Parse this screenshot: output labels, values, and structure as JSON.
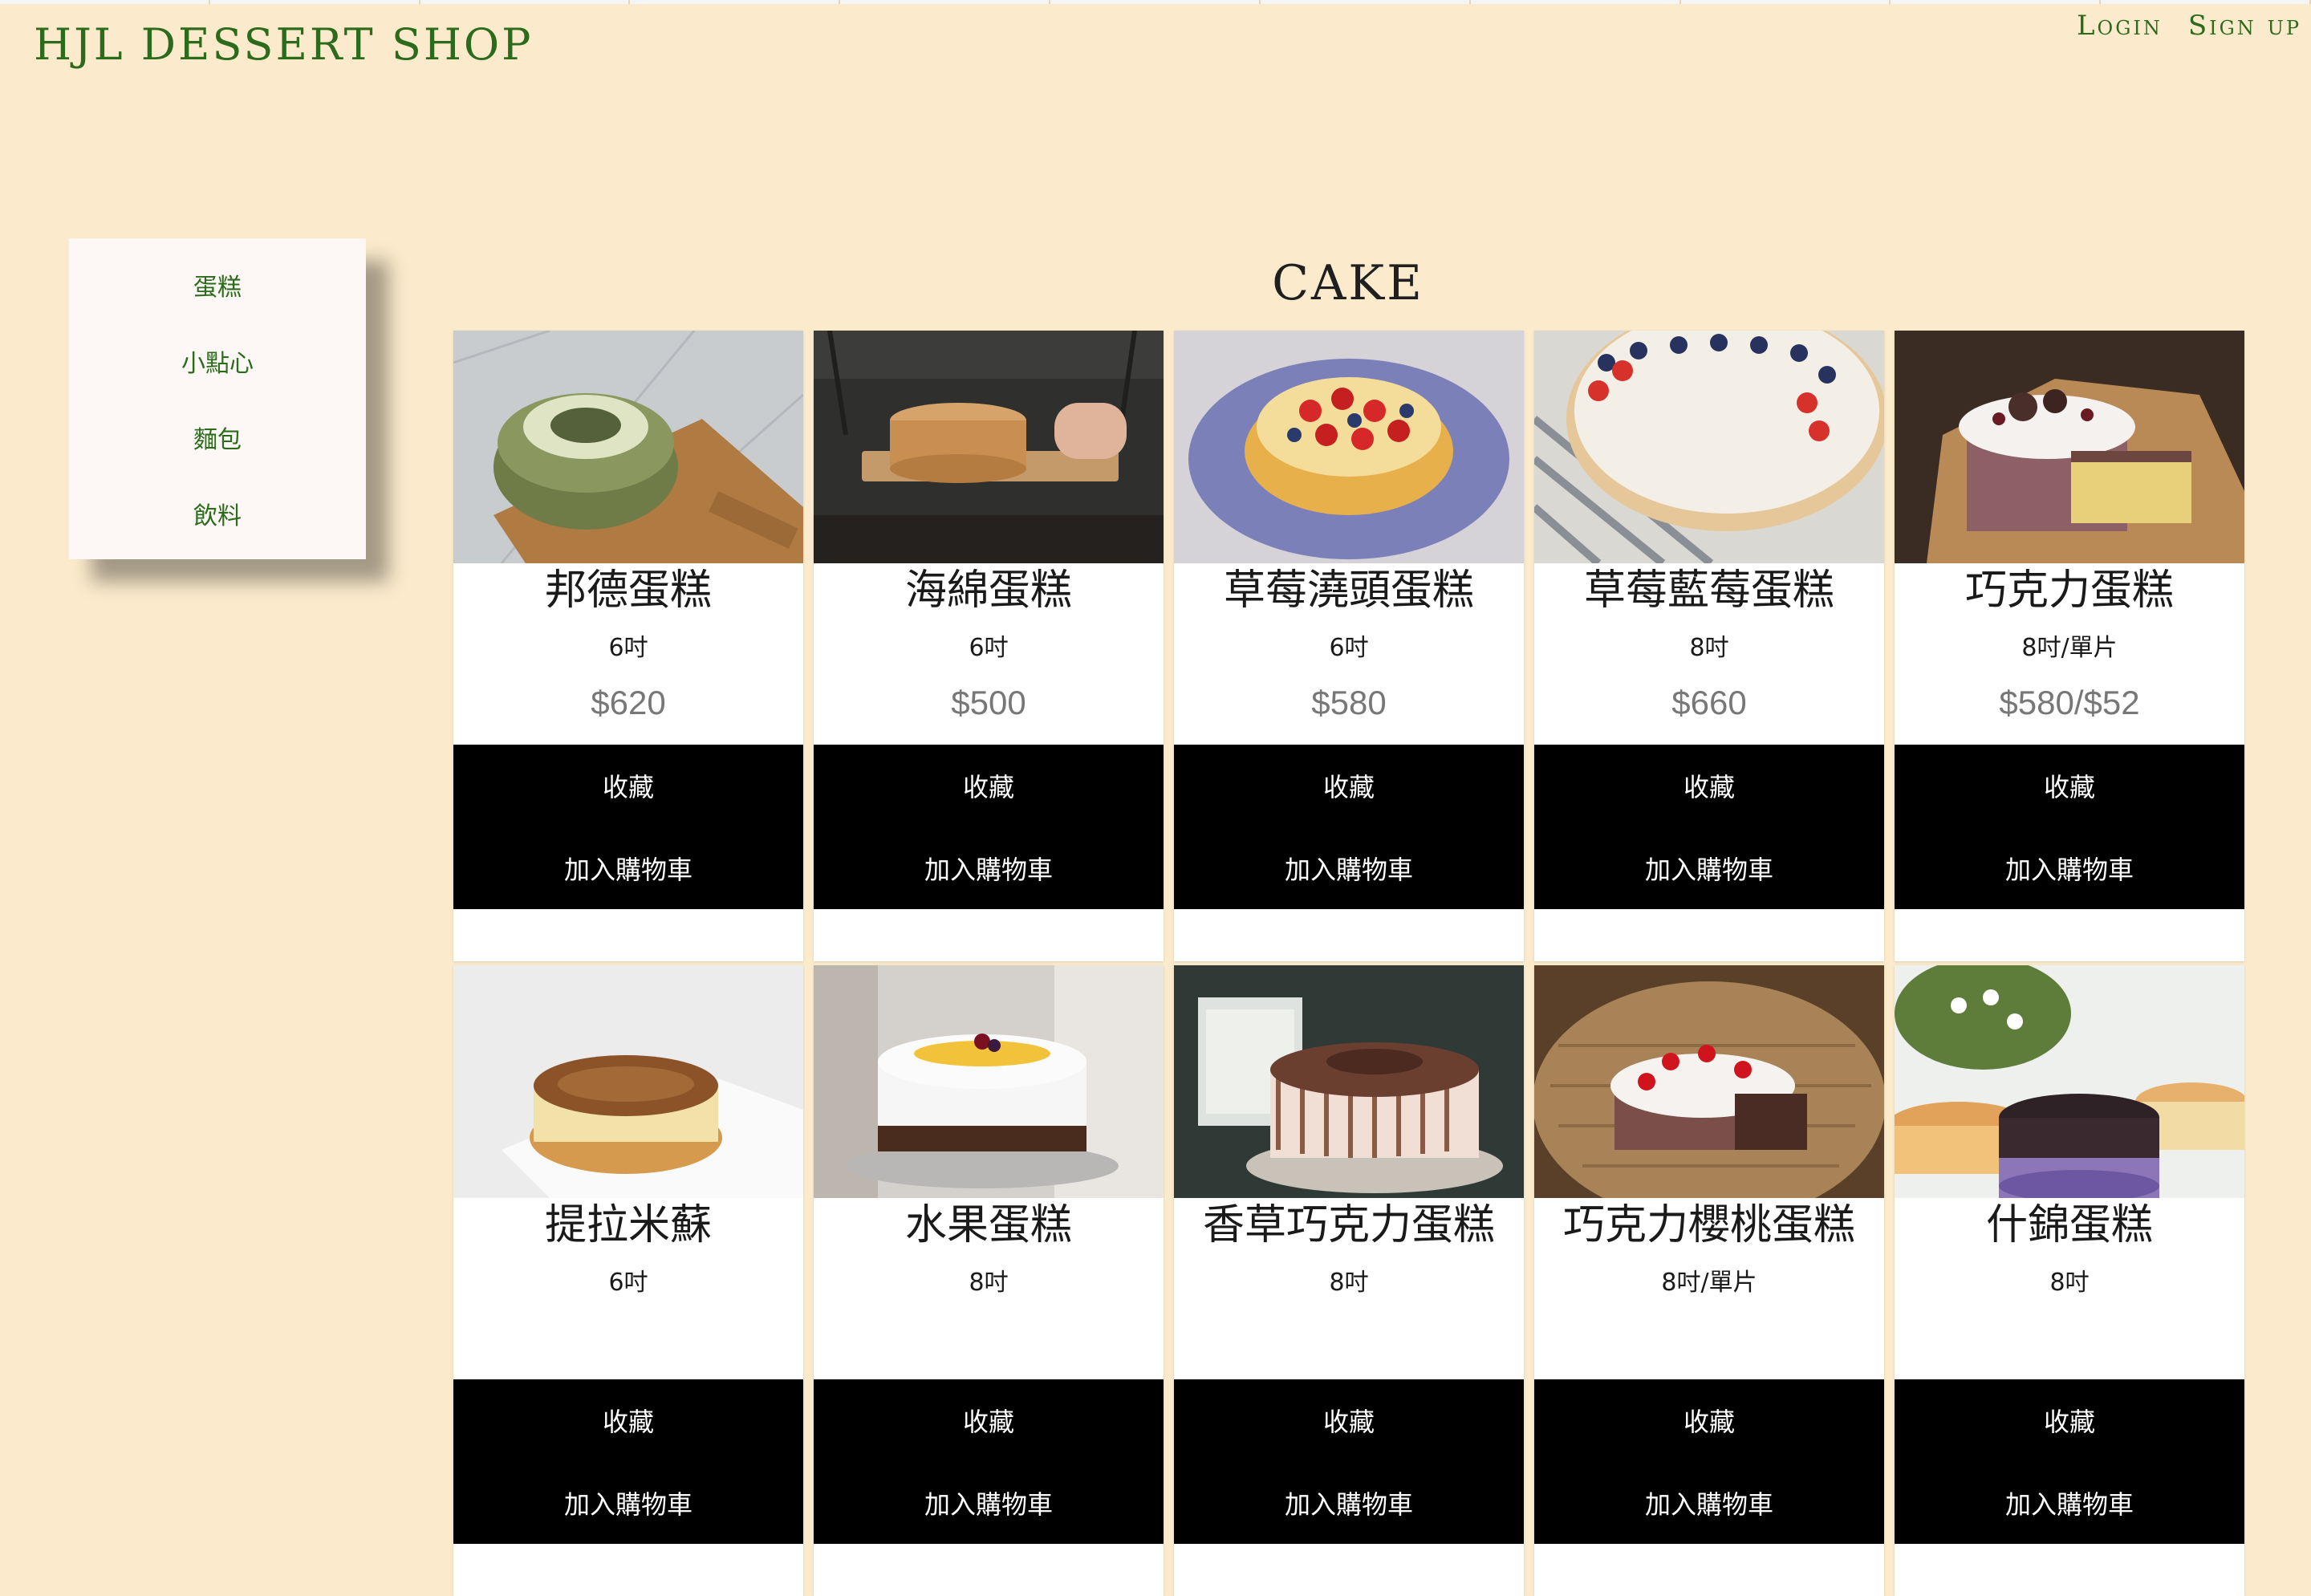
{
  "brand": "HJL DESSERT SHOP",
  "auth": {
    "login": "Login",
    "signup": "Sign up"
  },
  "sidebar": {
    "items": [
      {
        "label": "蛋糕"
      },
      {
        "label": "小點心"
      },
      {
        "label": "麵包"
      },
      {
        "label": "飲料"
      }
    ]
  },
  "section_title": "CAKE",
  "actions": {
    "favorite": "收藏",
    "add_to_cart": "加入購物車"
  },
  "products": [
    {
      "name": "邦德蛋糕",
      "size": "6吋",
      "price": "$620"
    },
    {
      "name": "海綿蛋糕",
      "size": "6吋",
      "price": "$500"
    },
    {
      "name": "草莓澆頭蛋糕",
      "size": "6吋",
      "price": "$580"
    },
    {
      "name": "草莓藍莓蛋糕",
      "size": "8吋",
      "price": "$660"
    },
    {
      "name": "巧克力蛋糕",
      "size": "8吋/單片",
      "price": "$580/$52"
    },
    {
      "name": "提拉米蘇",
      "size": "6吋",
      "price": ""
    },
    {
      "name": "水果蛋糕",
      "size": "8吋",
      "price": ""
    },
    {
      "name": "香草巧克力蛋糕",
      "size": "8吋",
      "price": ""
    },
    {
      "name": "巧克力櫻桃蛋糕",
      "size": "8吋/單片",
      "price": ""
    },
    {
      "name": "什錦蛋糕",
      "size": "8吋",
      "price": ""
    }
  ],
  "colors": {
    "background": "#fbebcc",
    "brand_green": "#2c6b1c",
    "action_bar": "#000000"
  }
}
